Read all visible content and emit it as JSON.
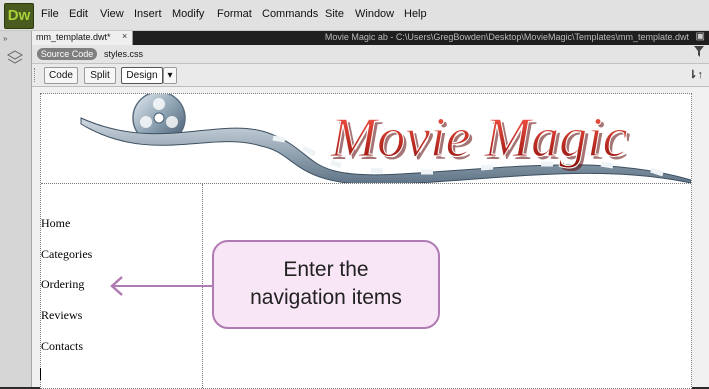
{
  "app": {
    "logo_text": "Dw"
  },
  "menu": [
    "File",
    "Edit",
    "View",
    "Insert",
    "Modify",
    "Format",
    "Commands",
    "Site",
    "Window",
    "Help"
  ],
  "document": {
    "tab_label": "mm_template.dwt*",
    "close_glyph": "×",
    "path": "Movie Magic ab - C:\\Users\\GregBowden\\Desktop\\MovieMagic\\Templates\\mm_template.dwt",
    "source_code_label": "Source Code",
    "related_file": "styles.css"
  },
  "toolbar": {
    "code": "Code",
    "split": "Split",
    "design": "Design",
    "sort_glyph": "⇂↑"
  },
  "banner": {
    "title": "Movie Magic"
  },
  "nav_items": [
    "Home",
    "Categories",
    "Ordering",
    "Reviews",
    "Contacts"
  ],
  "callout": {
    "line1": "Enter the",
    "line2": "navigation items"
  },
  "colors": {
    "callout_fill": "#f8e6f6",
    "callout_border": "#b07ab2",
    "title_red": "#c21e18",
    "logo_green": "#a6cf3a"
  }
}
